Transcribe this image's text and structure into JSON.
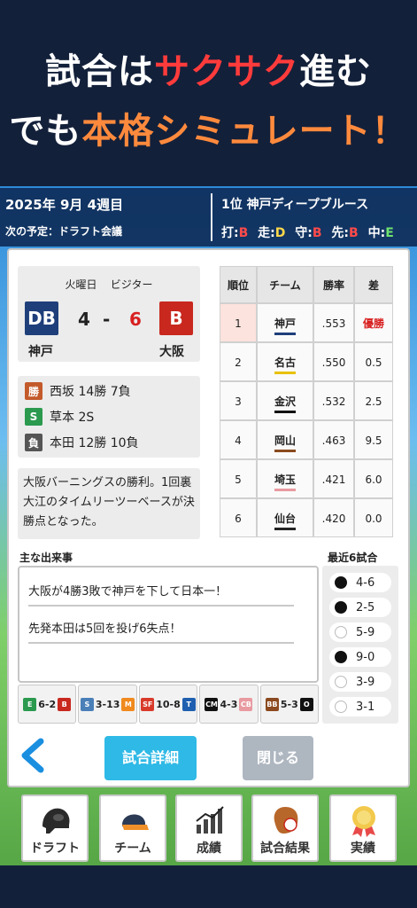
{
  "promo": {
    "line1": [
      {
        "text": "試合は",
        "color": "white"
      },
      {
        "text": "サクサク",
        "color": "red"
      },
      {
        "text": "進む",
        "color": "white"
      }
    ],
    "line2": [
      {
        "text": "でも",
        "color": "white"
      },
      {
        "text": "本格シミュレート",
        "color": "orange"
      },
      {
        "text": "！",
        "color": "orange"
      }
    ]
  },
  "status": {
    "date": "2025年 9月 4週目",
    "next": "次の予定：ドラフト会議",
    "leader": "1位 神戸ディープブルース",
    "grades": [
      {
        "label": "打:",
        "grade": "B",
        "color": "red"
      },
      {
        "label": "走:",
        "grade": "D",
        "color": "yellow"
      },
      {
        "label": "守:",
        "grade": "B",
        "color": "red"
      },
      {
        "label": "先:",
        "grade": "B",
        "color": "red"
      },
      {
        "label": "中:",
        "grade": "E",
        "color": "green"
      }
    ]
  },
  "game": {
    "day": "火曜日",
    "venue": "ビジター",
    "away_badge": "DB",
    "home_badge": "B",
    "away_score": "4",
    "dash": "-",
    "home_score": "6",
    "away_team": "神戸",
    "home_team": "大阪"
  },
  "pitchers": [
    {
      "tag": "勝",
      "text": "西坂 14勝 7負"
    },
    {
      "tag": "S",
      "text": "草本 2S"
    },
    {
      "tag": "負",
      "text": "本田 12勝 10負"
    }
  ],
  "summary": "大阪バーニングスの勝利。1回裏大江のタイムリーツーベースが決勝点となった。",
  "standings": {
    "headers": [
      "順位",
      "チーム",
      "勝率",
      "差"
    ],
    "rows": [
      {
        "rank": "1",
        "team": "神戸",
        "pct": ".553",
        "gb": "優勝",
        "color": "#1f3f7a"
      },
      {
        "rank": "2",
        "team": "名古",
        "pct": ".550",
        "gb": "0.5",
        "color": "#e8c200"
      },
      {
        "rank": "3",
        "team": "金沢",
        "pct": ".532",
        "gb": "2.5",
        "color": "#111111"
      },
      {
        "rank": "4",
        "team": "岡山",
        "pct": ".463",
        "gb": "9.5",
        "color": "#8b4a1f"
      },
      {
        "rank": "5",
        "team": "埼玉",
        "pct": ".421",
        "gb": "6.0",
        "color": "#e89aa0"
      },
      {
        "rank": "6",
        "team": "仙台",
        "pct": ".420",
        "gb": "0.0",
        "color": "#222222"
      }
    ]
  },
  "events": {
    "label": "主な出来事",
    "items": [
      "大阪が4勝3敗で神戸を下して日本一！",
      "先発本田は5回を投げ6失点！"
    ]
  },
  "recent": {
    "label": "最近6試合",
    "items": [
      {
        "score": "4-6",
        "result": "win"
      },
      {
        "score": "2-5",
        "result": "win"
      },
      {
        "score": "5-9",
        "result": "lose"
      },
      {
        "score": "9-0",
        "result": "win"
      },
      {
        "score": "3-9",
        "result": "lose"
      },
      {
        "score": "3-1",
        "result": "lose"
      }
    ]
  },
  "other_scores": [
    {
      "left": "E",
      "left_color": "#2b9a4f",
      "score": "6-2",
      "right": "B",
      "right_color": "#c8281e"
    },
    {
      "left": "S",
      "left_color": "#4a7fb8",
      "score": "3-13",
      "right": "M",
      "right_color": "#f08a1e"
    },
    {
      "left": "SF",
      "left_color": "#d83a2a",
      "score": "10-8",
      "right": "T",
      "right_color": "#1f5fb0"
    },
    {
      "left": "CM",
      "left_color": "#111111",
      "score": "4-3",
      "right": "CB",
      "right_color": "#e89aa0"
    },
    {
      "left": "BB",
      "left_color": "#8b4a1f",
      "score": "5-3",
      "right": "O",
      "right_color": "#111111"
    }
  ],
  "buttons": {
    "back": "<",
    "detail": "試合詳細",
    "close": "閉じる"
  },
  "nav": [
    {
      "label": "ドラフト",
      "icon": "helmet-icon"
    },
    {
      "label": "チーム",
      "icon": "cap-icon"
    },
    {
      "label": "成績",
      "icon": "chart-icon"
    },
    {
      "label": "試合結果",
      "icon": "glove-icon"
    },
    {
      "label": "実績",
      "icon": "medal-icon"
    }
  ]
}
